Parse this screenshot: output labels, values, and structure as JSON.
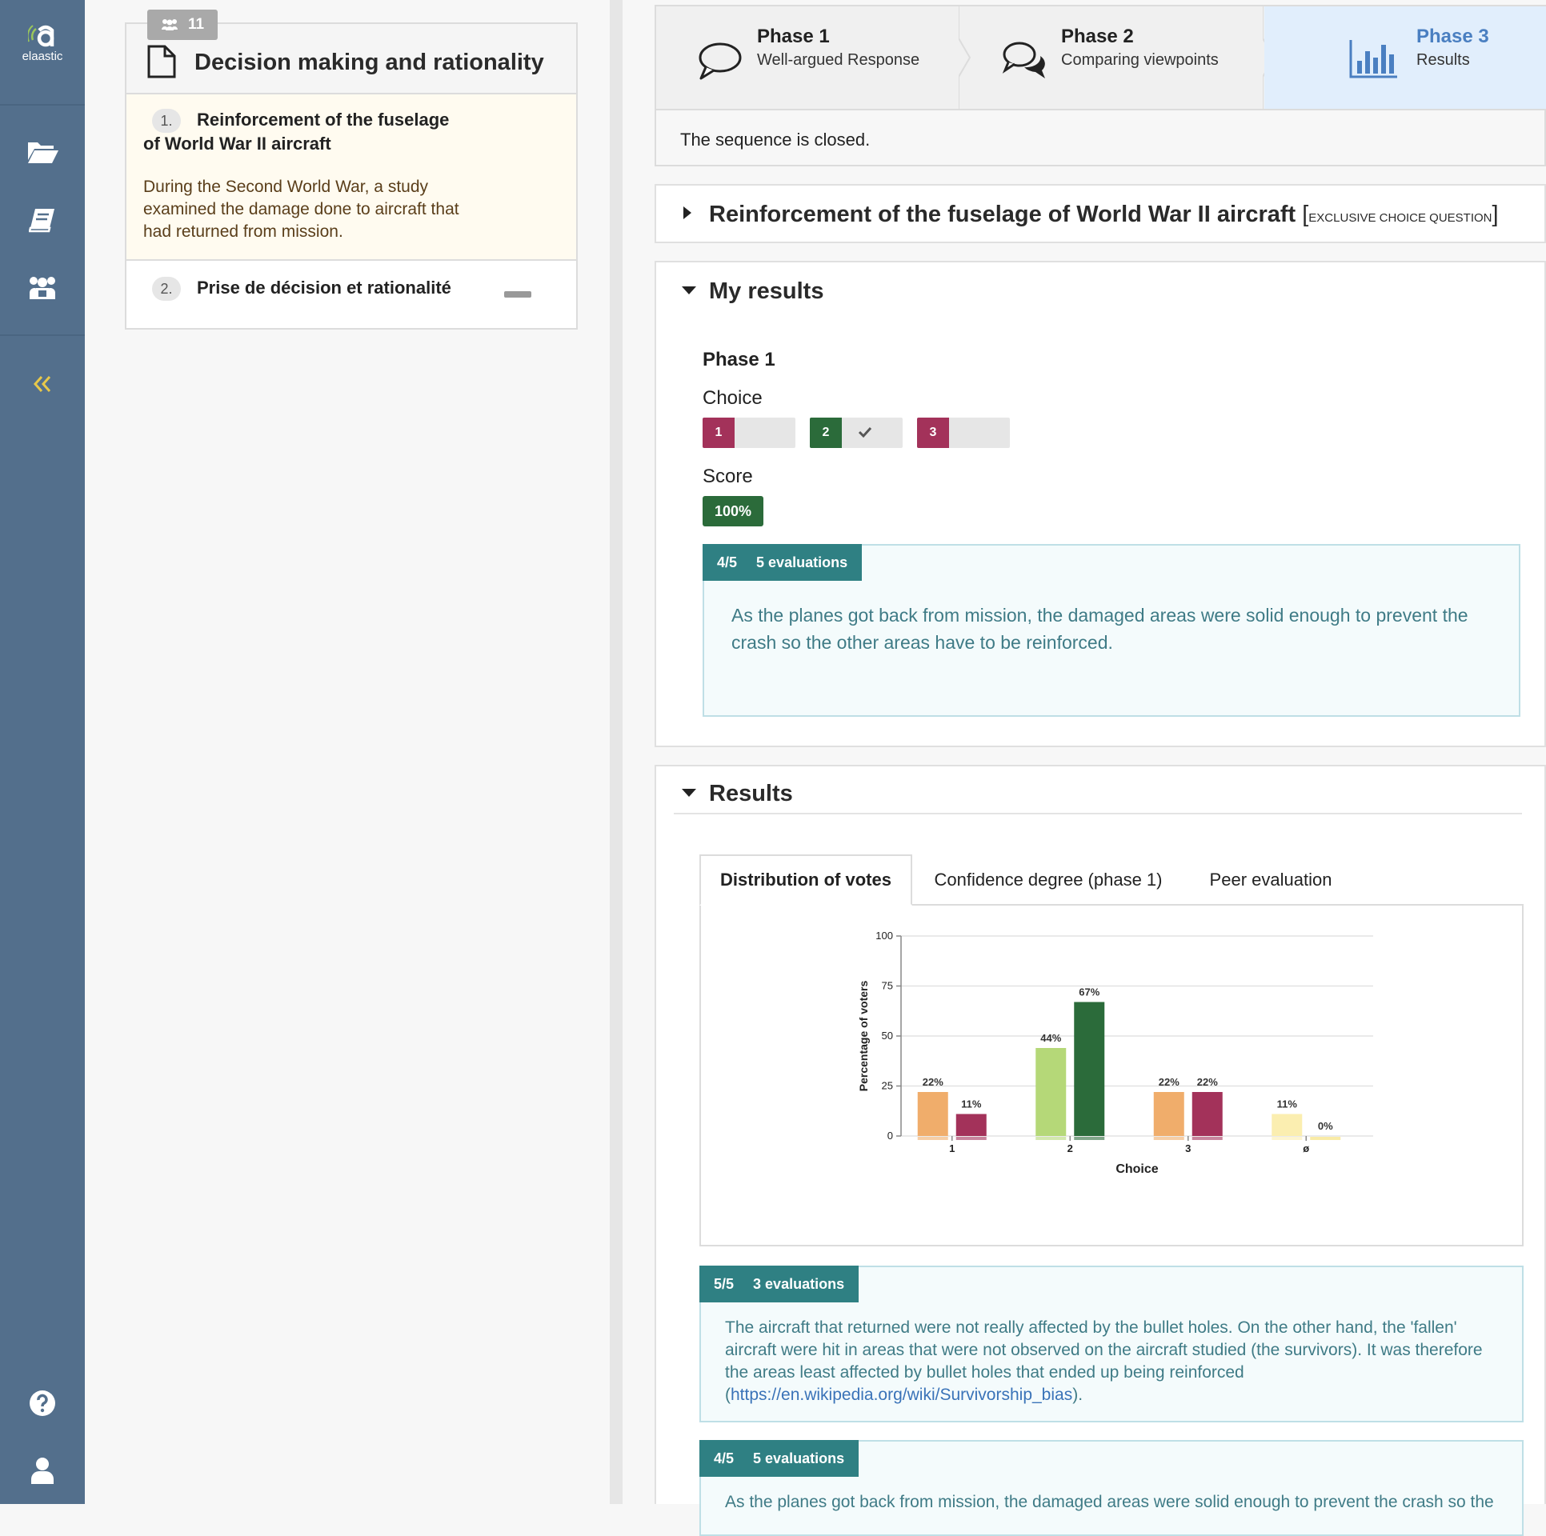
{
  "sidebar": {
    "logo_text": "elaastic",
    "icons": [
      "folder-open-icon",
      "book-icon",
      "users-icon",
      "collapse-icon",
      "help-icon",
      "user-icon"
    ]
  },
  "sequence": {
    "participants": "11",
    "title": "Decision making and rationality",
    "items": [
      {
        "number": "1.",
        "title_line1": "Reinforcement of the fuselage",
        "title_line2": "of World War II aircraft",
        "description": "During the Second World War, a study examined the damage done to aircraft that had returned from mission."
      },
      {
        "number": "2.",
        "title": "Prise de décision et rationalité"
      }
    ]
  },
  "phases": [
    {
      "title": "Phase 1",
      "subtitle": "Well-argued Response"
    },
    {
      "title": "Phase 2",
      "subtitle": "Comparing viewpoints"
    },
    {
      "title": "Phase 3",
      "subtitle": "Results"
    }
  ],
  "status": "The sequence is closed.",
  "question": {
    "title": "Reinforcement of the fuselage of World War II aircraft",
    "type_open": "[",
    "type": "EXCLUSIVE CHOICE QUESTION",
    "type_close": "]"
  },
  "my_results": {
    "title": "My results",
    "phase_label": "Phase 1",
    "choice_label": "Choice",
    "choices": [
      {
        "number": "1",
        "color": "#a3325a",
        "selected": false
      },
      {
        "number": "2",
        "color": "#2b6b3a",
        "selected": true
      },
      {
        "number": "3",
        "color": "#a3325a",
        "selected": false
      }
    ],
    "score_label": "Score",
    "score": "100%",
    "evaluation": {
      "grade": "4/5",
      "count": "5 evaluations",
      "text": "As the planes got back from mission, the damaged areas were solid enough to prevent the crash so the other areas have to be reinforced."
    }
  },
  "results": {
    "title": "Results",
    "tabs": [
      "Distribution of votes",
      "Confidence degree (phase 1)",
      "Peer evaluation"
    ],
    "active_tab": "Distribution of votes",
    "evaluations": [
      {
        "grade": "5/5",
        "count": "3 evaluations",
        "text": "The aircraft that returned were not really affected by the bullet holes. On the other hand, the 'fallen' aircraft were hit in areas that were not observed on the aircraft studied (the survivors). It was therefore the areas least affected by bullet holes that ended up being reinforced  (",
        "link": "https://en.wikipedia.org/wiki/Survivorship_bias",
        "text_end": ")."
      },
      {
        "grade": "4/5",
        "count": "5 evaluations",
        "text": "As the planes got back from mission, the damaged areas were solid enough to prevent the crash so the"
      }
    ]
  },
  "chart_data": {
    "type": "bar",
    "categories": [
      "1",
      "2",
      "3",
      "ø"
    ],
    "xlabel": "Choice",
    "ylabel": "Percentage of voters",
    "ylim": [
      0,
      100
    ],
    "yticks": [
      0,
      25,
      50,
      75,
      100
    ],
    "grid": true,
    "series": [
      {
        "values": [
          22,
          44,
          22,
          11
        ],
        "labels": [
          "22%",
          "44%",
          "22%",
          "11%"
        ],
        "colors": [
          "#f0ad6b",
          "#b5d878",
          "#f0ad6b",
          "#fbeeb0"
        ]
      },
      {
        "values": [
          11,
          67,
          22,
          0
        ],
        "labels": [
          "11%",
          "67%",
          "22%",
          "0%"
        ],
        "colors": [
          "#a3325a",
          "#2b6b3a",
          "#a3325a",
          "#f5dd6b"
        ]
      }
    ]
  }
}
